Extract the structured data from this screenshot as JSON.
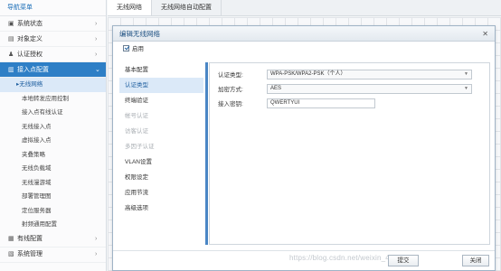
{
  "sidebar": {
    "header": "导航菜单",
    "groups_top": [
      {
        "icon": "▣",
        "label": "系统状态"
      },
      {
        "icon": "▤",
        "label": "对象定义"
      },
      {
        "icon": "♟",
        "label": "认证授权"
      }
    ],
    "active_group": {
      "icon": "▥",
      "label": "接入点配置"
    },
    "sub_items": [
      "无线网络",
      "本地转发应用控制",
      "接入点有线认证",
      "无线接入点",
      "虚拟接入点",
      "夹叠策略",
      "无线负载域",
      "无线漫游域",
      "部署管理图",
      "定位服务器",
      "射频通用配置"
    ],
    "groups_bottom": [
      {
        "icon": "▦",
        "label": "有线配置"
      },
      {
        "icon": "▧",
        "label": "系统管理"
      }
    ]
  },
  "tabs": [
    "无线网络",
    "无线网络自动配置"
  ],
  "dialog": {
    "title": "编辑无线网络",
    "close_glyph": "✕",
    "enable_label": "启用",
    "nav": [
      {
        "label": "基本配置",
        "state": "normal"
      },
      {
        "label": "认证类型",
        "state": "selected"
      },
      {
        "label": "终端验证",
        "state": "normal"
      },
      {
        "label": "帐号认证",
        "state": "disabled"
      },
      {
        "label": "访客认证",
        "state": "disabled"
      },
      {
        "label": "多因子认证",
        "state": "disabled"
      },
      {
        "label": "VLAN设置",
        "state": "normal"
      },
      {
        "label": "权限设定",
        "state": "normal"
      },
      {
        "label": "应用节流",
        "state": "normal"
      },
      {
        "label": "高级选项",
        "state": "normal"
      }
    ],
    "fields": {
      "auth_type": {
        "label": "认证类型:",
        "value": "WPA-PSK/WPA2-PSK（个人）"
      },
      "encryption": {
        "label": "加密方式:",
        "value": "AES"
      },
      "key": {
        "label": "接入密钥:",
        "value": "QWERTYUI"
      }
    },
    "watermark": "https://blog.csdn.net/weixin_45776850",
    "buttons": {
      "save": "提交",
      "close": "关闭"
    }
  },
  "colors": {
    "accent": "#2e7fc6",
    "selected_bg": "#dbe9f8"
  }
}
